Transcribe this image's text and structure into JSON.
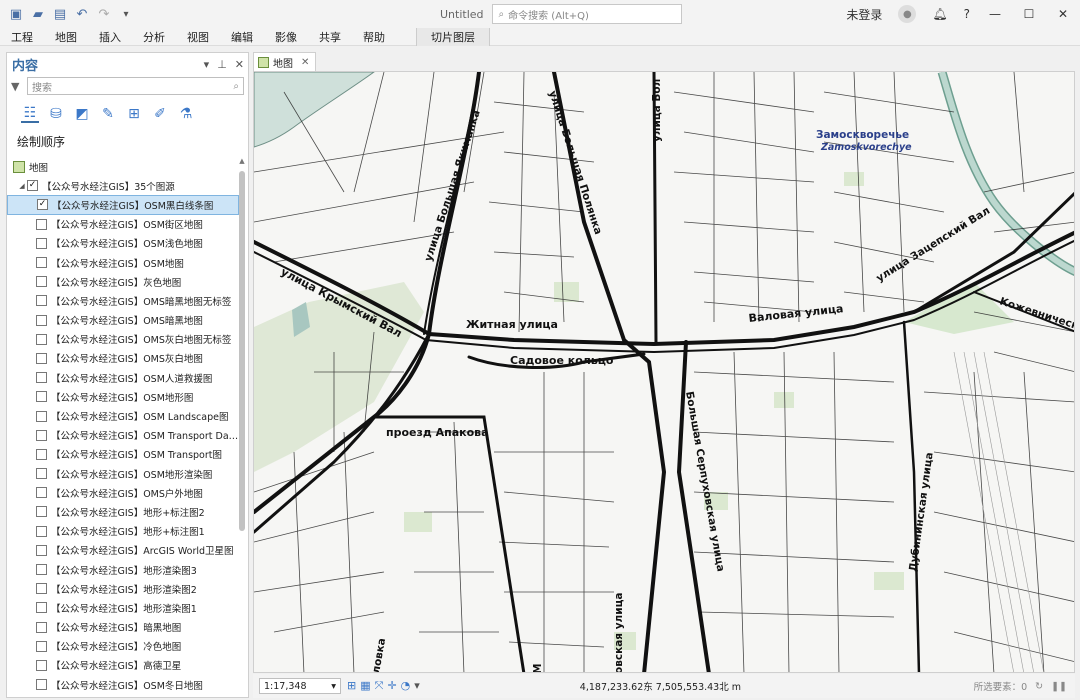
{
  "titlebar": {
    "doc_title": "Untitled",
    "search_placeholder": "命令搜索 (Alt+Q)",
    "user": "未登录",
    "help": "?"
  },
  "ribbon": {
    "tabs": [
      "工程",
      "地图",
      "插入",
      "分析",
      "视图",
      "编辑",
      "影像",
      "共享",
      "帮助"
    ],
    "special_tab": "切片图层"
  },
  "contents": {
    "title": "内容",
    "search_placeholder": "搜索",
    "section": "绘制顺序",
    "map_node": "地图",
    "group": "【公众号水经注GIS】35个图源",
    "layers": [
      {
        "label": "【公众号水经注GIS】OSM黑白线条图",
        "checked": true
      },
      {
        "label": "【公众号水经注GIS】OSM街区地图",
        "checked": false
      },
      {
        "label": "【公众号水经注GIS】OSM浅色地图",
        "checked": false
      },
      {
        "label": "【公众号水经注GIS】OSM地图",
        "checked": false
      },
      {
        "label": "【公众号水经注GIS】灰色地图",
        "checked": false
      },
      {
        "label": "【公众号水经注GIS】OMS暗黑地图无标签",
        "checked": false
      },
      {
        "label": "【公众号水经注GIS】OMS暗黑地图",
        "checked": false
      },
      {
        "label": "【公众号水经注GIS】OMS灰白地图无标签",
        "checked": false
      },
      {
        "label": "【公众号水经注GIS】OMS灰白地图",
        "checked": false
      },
      {
        "label": "【公众号水经注GIS】OSM人道救援图",
        "checked": false
      },
      {
        "label": "【公众号水经注GIS】OSM地形图",
        "checked": false
      },
      {
        "label": "【公众号水经注GIS】OSM Landscape图",
        "checked": false
      },
      {
        "label": "【公众号水经注GIS】OSM Transport Da…",
        "checked": false
      },
      {
        "label": "【公众号水经注GIS】OSM Transport图",
        "checked": false
      },
      {
        "label": "【公众号水经注GIS】OSM地形渲染图",
        "checked": false
      },
      {
        "label": "【公众号水经注GIS】OMS户外地图",
        "checked": false
      },
      {
        "label": "【公众号水经注GIS】地形+标注图2",
        "checked": false
      },
      {
        "label": "【公众号水经注GIS】地形+标注图1",
        "checked": false
      },
      {
        "label": "【公众号水经注GIS】ArcGIS World卫星图",
        "checked": false
      },
      {
        "label": "【公众号水经注GIS】地形渲染图3",
        "checked": false
      },
      {
        "label": "【公众号水经注GIS】地形渲染图2",
        "checked": false
      },
      {
        "label": "【公众号水经注GIS】地形渲染图1",
        "checked": false
      },
      {
        "label": "【公众号水经注GIS】暗黑地图",
        "checked": false
      },
      {
        "label": "【公众号水经注GIS】冷色地图",
        "checked": false
      },
      {
        "label": "【公众号水经注GIS】高德卫星",
        "checked": false
      },
      {
        "label": "【公众号水经注GIS】OSM冬日地图",
        "checked": false
      }
    ]
  },
  "map": {
    "tab_label": "地图",
    "labels": {
      "district_ru": "Замоскворечье",
      "district_en": "Zamoskvorechye",
      "zhitnaya": "Житная улица",
      "sadovoe": "Садовое кольцо",
      "valovaya": "Валовая улица",
      "krymsky": "улица Крымский Вал",
      "apakova": "проезд Апакова",
      "yakimanka": "улица Большая Якиманка",
      "polyanka": "улица Большая Полянка",
      "serpukhovskaya": "Большая Серпуховская улица",
      "zatsepsky": "улица Зацепский Вал",
      "dubininskaya": "Дубининская улица",
      "kozhevnicheskaya": "Кожевническа",
      "top_ulitsa_bol": "улица Бол",
      "bottom_ovskaya": "овская улица",
      "bottom_lovka": "ловка",
      "bottom_m": "М"
    }
  },
  "statusbar": {
    "scale": "1:17,348",
    "coords": "4,187,233.62东 7,505,553.43北 m",
    "selected_features": "所选要素：0"
  }
}
